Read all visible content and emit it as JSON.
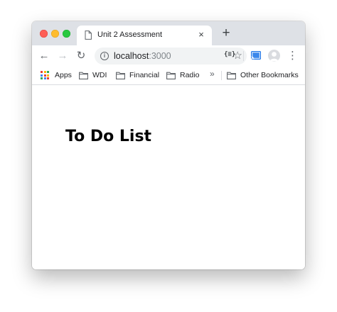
{
  "tab": {
    "title": "Unit 2 Assessment",
    "close_glyph": "×"
  },
  "new_tab_glyph": "+",
  "toolbar": {
    "back_glyph": "←",
    "forward_glyph": "→",
    "reload_glyph": "↻",
    "url_host": "localhost",
    "url_port": ":3000",
    "info_glyph": "i",
    "star_glyph": "☆",
    "extension_label": "{≡}",
    "menu_glyph": "⋮"
  },
  "bookmarks": {
    "items": [
      {
        "label": "Apps",
        "icon": "apps-grid-icon"
      },
      {
        "label": "WDI",
        "icon": "folder-icon"
      },
      {
        "label": "Financial",
        "icon": "folder-icon"
      },
      {
        "label": "Radio",
        "icon": "folder-icon"
      }
    ],
    "overflow_glyph": "»",
    "other": {
      "label": "Other Bookmarks",
      "icon": "folder-icon"
    }
  },
  "page": {
    "heading": "To Do List"
  },
  "colors": {
    "tabstrip": "#dee1e6",
    "traffic_red": "#fe5f57",
    "traffic_yellow": "#febc2e",
    "traffic_green": "#28c840",
    "cast_blue": "#1a73e8"
  }
}
